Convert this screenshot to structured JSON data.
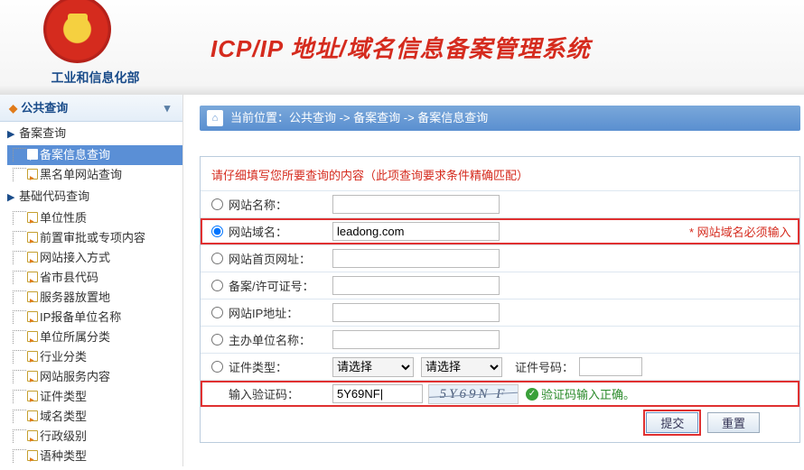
{
  "header": {
    "ministry_name": "工业和信息化部",
    "system_title": "ICP/IP 地址/域名信息备案管理系统"
  },
  "sidebar": {
    "section_title": "公共查询",
    "groups": [
      {
        "title": "备案查询",
        "items": [
          "备案信息查询",
          "黑名单网站查询"
        ]
      },
      {
        "title": "基础代码查询",
        "items": [
          "单位性质",
          "前置审批或专项内容",
          "网站接入方式",
          "省市县代码",
          "服务器放置地",
          "IP报备单位名称",
          "单位所属分类",
          "行业分类",
          "网站服务内容",
          "证件类型",
          "域名类型",
          "行政级别",
          "语种类型"
        ]
      }
    ],
    "selected_item": "备案信息查询"
  },
  "breadcrumb": {
    "prefix": "当前位置：",
    "parts": [
      "公共查询",
      "备案查询",
      "备案信息查询"
    ],
    "sep": " -> "
  },
  "form": {
    "hint": "请仔细填写您所要查询的内容（此项查询要求条件精确匹配）",
    "fields": {
      "site_name": "网站名称：",
      "site_domain": "网站域名：",
      "homepage": "网站首页网址：",
      "license": "备案/许可证号：",
      "ip_addr": "网站IP地址：",
      "sponsor": "主办单位名称：",
      "cert_type": "证件类型：",
      "cert_no": "证件号码：",
      "captcha": "输入验证码："
    },
    "values": {
      "domain_input": "leadong.com",
      "captcha_input": "5Y69NF|"
    },
    "select_placeholder": "请选择",
    "required_note": "* 网站域名必须输入",
    "captcha_image_text": "5Y69N F",
    "captcha_ok_text": "验证码输入正确。",
    "buttons": {
      "submit": "提交",
      "reset": "重置"
    },
    "selected_radio": "site_domain"
  }
}
